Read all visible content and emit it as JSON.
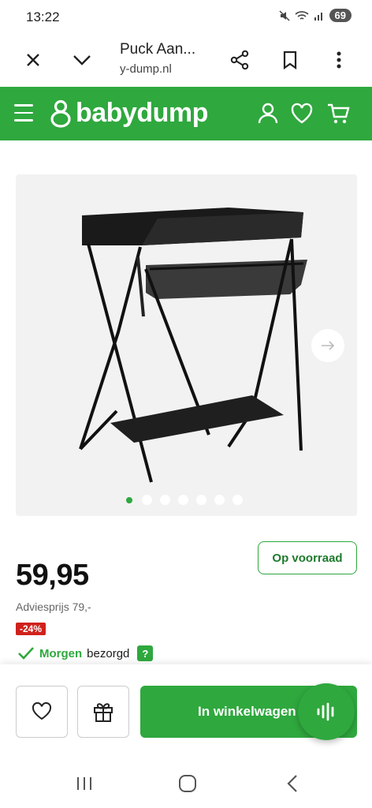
{
  "status": {
    "time": "13:22",
    "battery": "69"
  },
  "browser": {
    "title": "Puck Aan...",
    "url": "y-dump.nl"
  },
  "site": {
    "logo_text": "babydump",
    "brand_color": "#2fa83e"
  },
  "gallery": {
    "dot_count": 7,
    "active_index": 0
  },
  "product": {
    "stock_label": "Op voorraad",
    "price": "59,95",
    "advies": "Adviesprijs 79,-",
    "discount": "-24%",
    "delivery_day": "Morgen",
    "delivery_text": "bezorgd",
    "help": "?"
  },
  "actions": {
    "cart_label": "In winkelwagen"
  },
  "icons": {
    "close": "close-icon",
    "chevron": "chevron-down-icon",
    "share": "share-icon",
    "bookmark": "bookmark-icon",
    "more": "more-vertical-icon",
    "menu": "hamburger-icon",
    "account": "user-icon",
    "wishlist": "heart-icon",
    "cart": "cart-icon",
    "next": "arrow-right-icon",
    "gift": "gift-icon",
    "voice": "voice-icon"
  }
}
